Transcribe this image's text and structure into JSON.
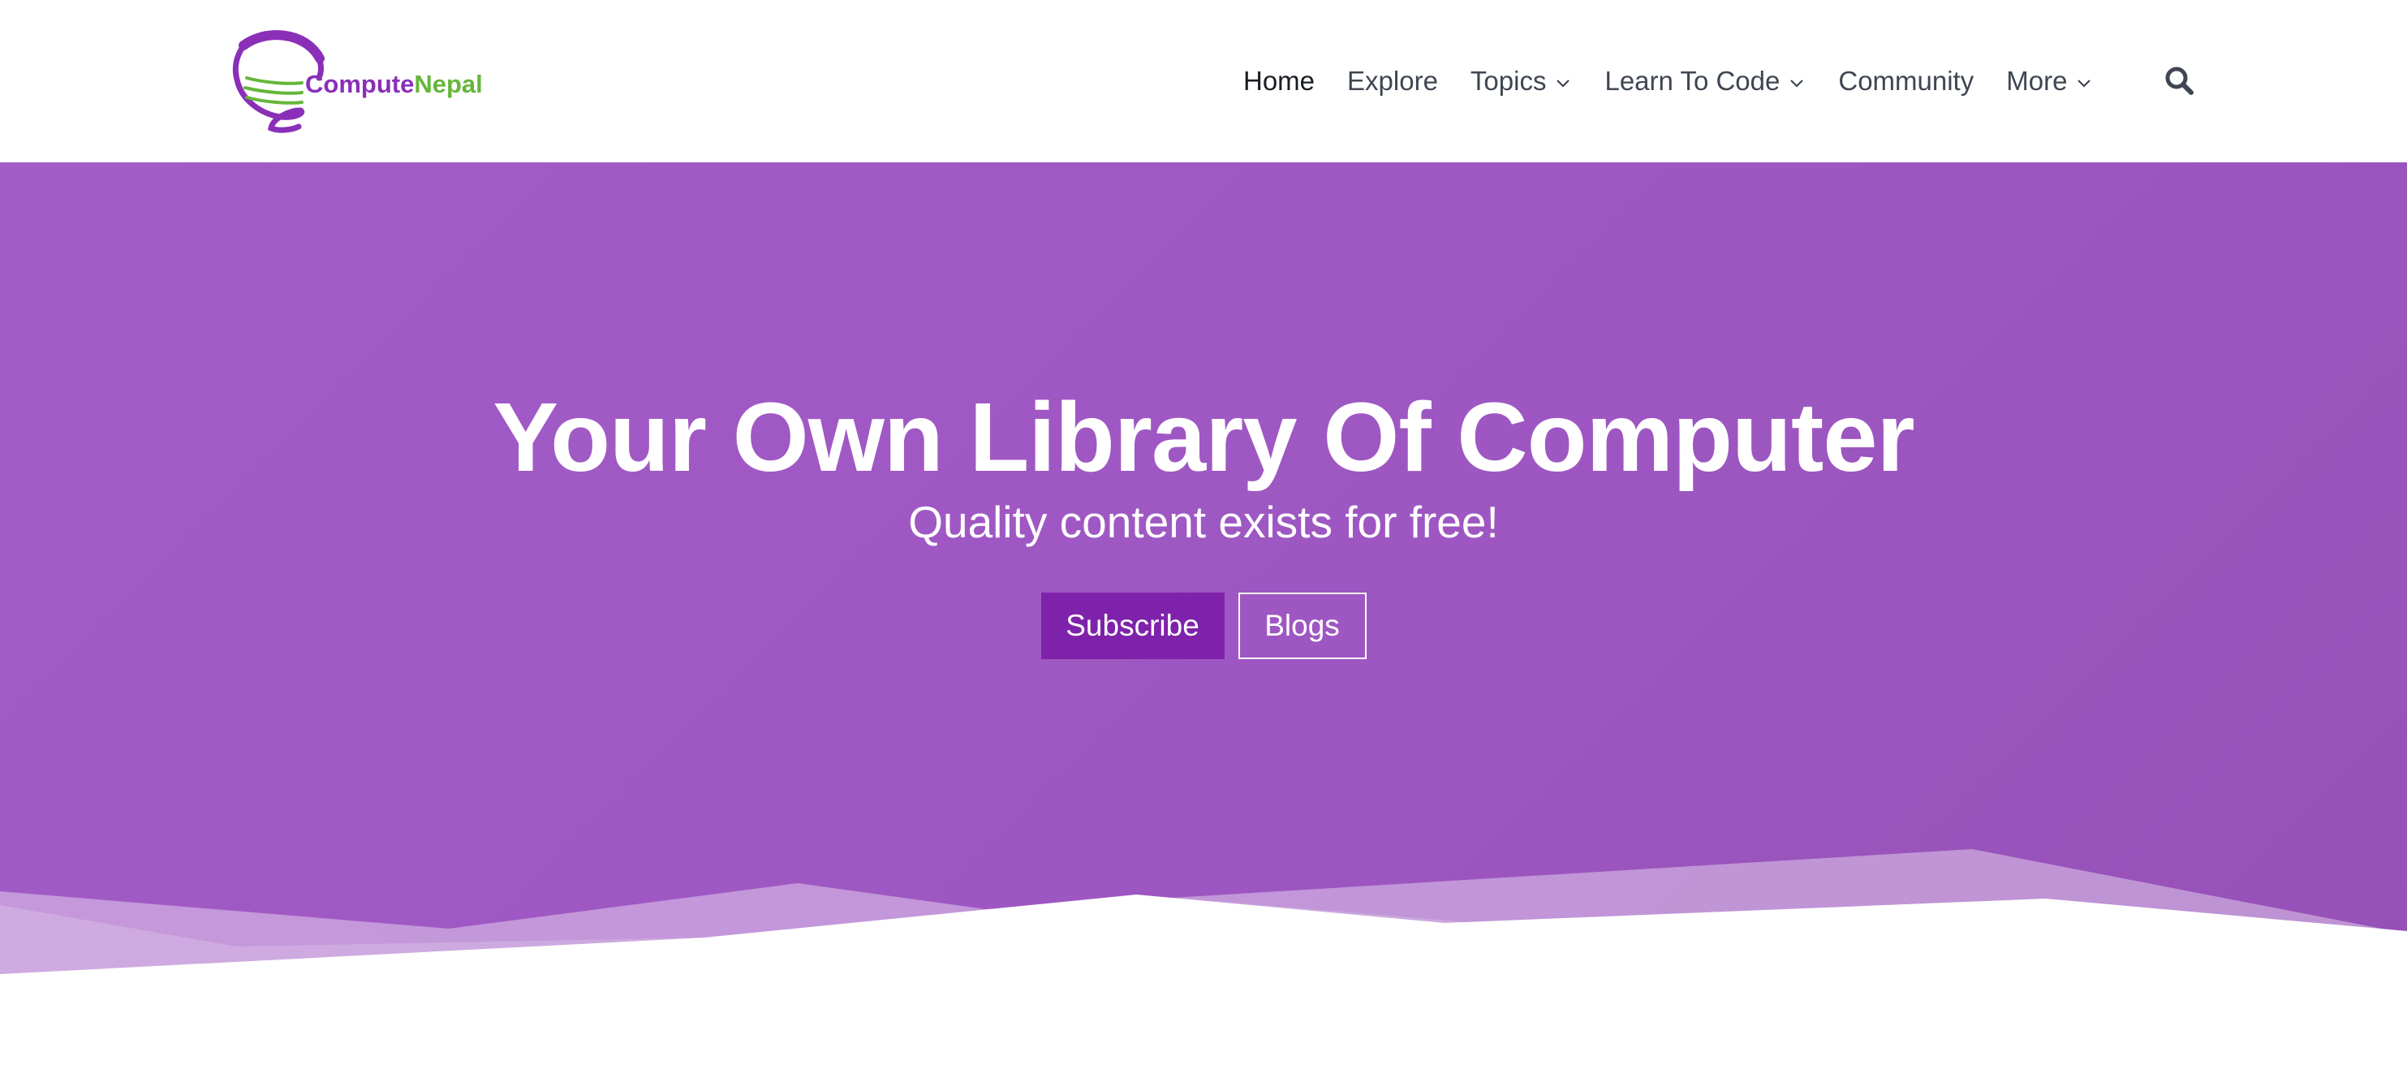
{
  "brand": {
    "name_part1": "Compute",
    "name_part2": "Nepal",
    "primary_color": "#8a2fb8",
    "secondary_color": "#65b63a"
  },
  "nav": {
    "items": [
      {
        "label": "Home",
        "active": true,
        "has_dropdown": false
      },
      {
        "label": "Explore",
        "active": false,
        "has_dropdown": false
      },
      {
        "label": "Topics",
        "active": false,
        "has_dropdown": true
      },
      {
        "label": "Learn To Code",
        "active": false,
        "has_dropdown": true
      },
      {
        "label": "Community",
        "active": false,
        "has_dropdown": false
      },
      {
        "label": "More",
        "active": false,
        "has_dropdown": true
      }
    ],
    "search_icon": "search-icon"
  },
  "hero": {
    "title": "Your Own Library Of Computer",
    "subtitle": "Quality content exists for free!",
    "buttons": {
      "subscribe_label": "Subscribe",
      "blogs_label": "Blogs"
    },
    "background_color": "#a05ac5",
    "button_color": "#7e22ab"
  }
}
